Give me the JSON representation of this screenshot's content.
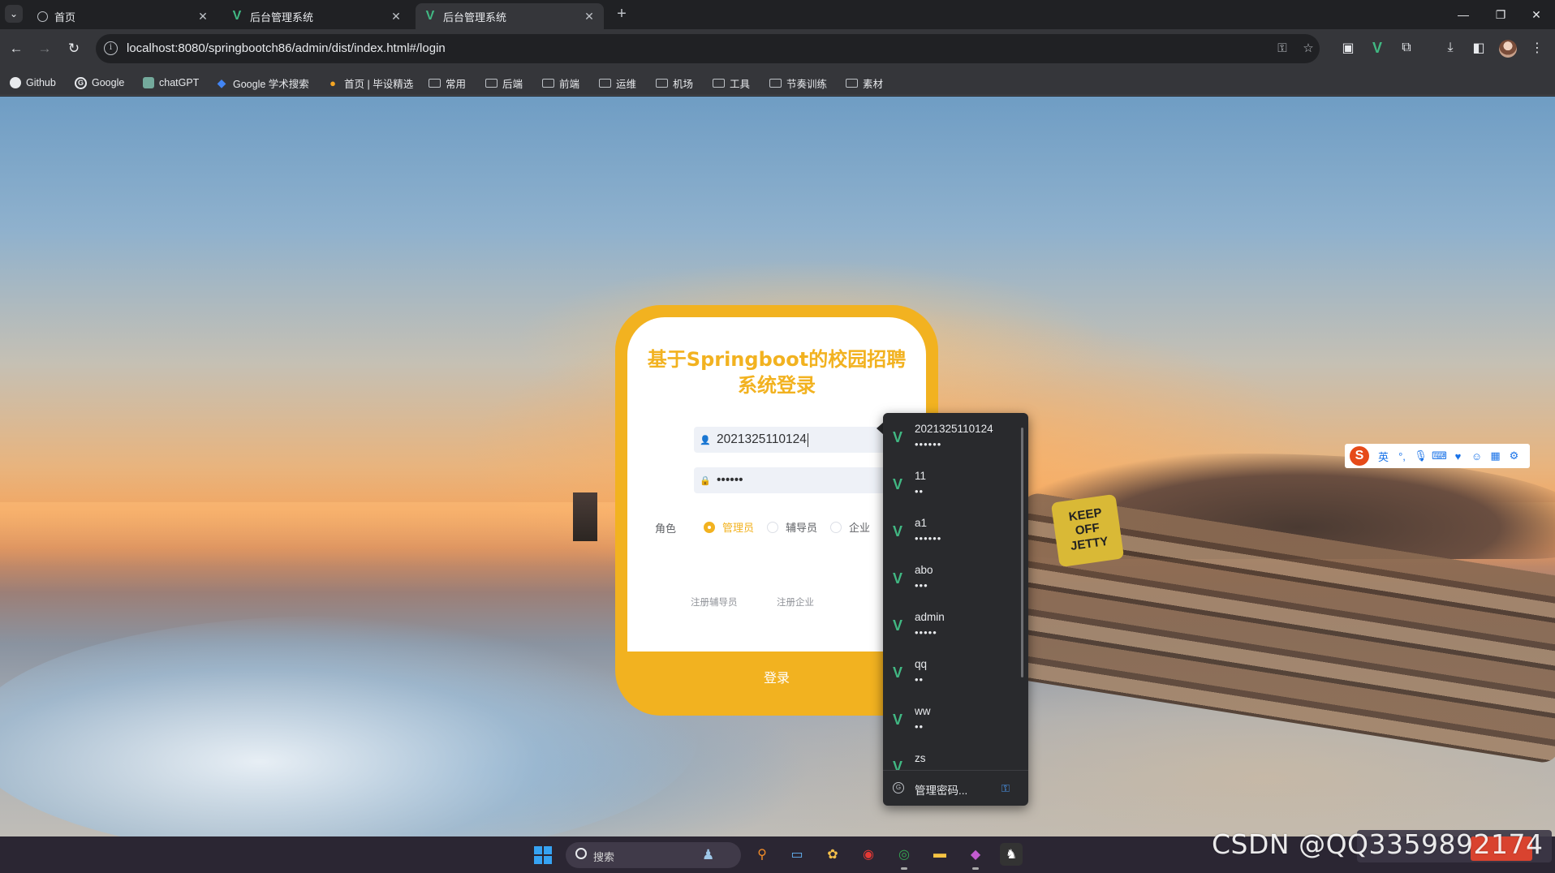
{
  "browser": {
    "tabs": [
      {
        "title": "首页",
        "icon": "globe-icon",
        "active": false
      },
      {
        "title": "后台管理系统",
        "icon": "vue-icon",
        "active": false
      },
      {
        "title": "后台管理系统",
        "icon": "vue-icon",
        "active": true
      }
    ],
    "new_tab": "+",
    "window_controls": {
      "minimize": "—",
      "restore": "❐",
      "close": "✕"
    },
    "url": "localhost:8080/springbootch86/admin/dist/index.html#/login",
    "bookmarks": [
      {
        "label": "Github",
        "icon": "github-icon"
      },
      {
        "label": "Google",
        "icon": "google-icon"
      },
      {
        "label": "chatGPT",
        "icon": "chatgpt-icon"
      },
      {
        "label": "Google 学术搜索",
        "icon": "scholar-icon"
      },
      {
        "label": "首页 | 毕设精选",
        "icon": "bishe-icon"
      },
      {
        "label": "常用",
        "icon": "folder-icon"
      },
      {
        "label": "后端",
        "icon": "folder-icon"
      },
      {
        "label": "前端",
        "icon": "folder-icon"
      },
      {
        "label": "运维",
        "icon": "folder-icon"
      },
      {
        "label": "机场",
        "icon": "folder-icon"
      },
      {
        "label": "工具",
        "icon": "folder-icon"
      },
      {
        "label": "节奏训练",
        "icon": "folder-icon"
      },
      {
        "label": "素材",
        "icon": "folder-icon"
      }
    ]
  },
  "login": {
    "title": "基于Springboot的校园招聘系统登录",
    "username_value": "2021325110124",
    "password_mask": "••••••",
    "role_label": "角色",
    "roles": [
      {
        "label": "管理员",
        "checked": true
      },
      {
        "label": "辅导员",
        "checked": false
      },
      {
        "label": "企业",
        "checked": false
      }
    ],
    "register_links": [
      "注册辅导员",
      "注册企业"
    ],
    "login_button": "登录",
    "accent_color": "#f2b220"
  },
  "autofill": {
    "items": [
      {
        "username": "2021325110124",
        "password_mask": "••••••"
      },
      {
        "username": "11",
        "password_mask": "••"
      },
      {
        "username": "a1",
        "password_mask": "••••••"
      },
      {
        "username": "abo",
        "password_mask": "•••"
      },
      {
        "username": "admin",
        "password_mask": "•••••"
      },
      {
        "username": "qq",
        "password_mask": "••"
      },
      {
        "username": "ww",
        "password_mask": "••"
      },
      {
        "username": "zs",
        "password_mask": ""
      }
    ],
    "manage_label": "管理密码..."
  },
  "ime": {
    "mode": "英"
  },
  "taskbar": {
    "search_label": "搜索"
  },
  "watermark": "CSDN @QQ3359892174"
}
